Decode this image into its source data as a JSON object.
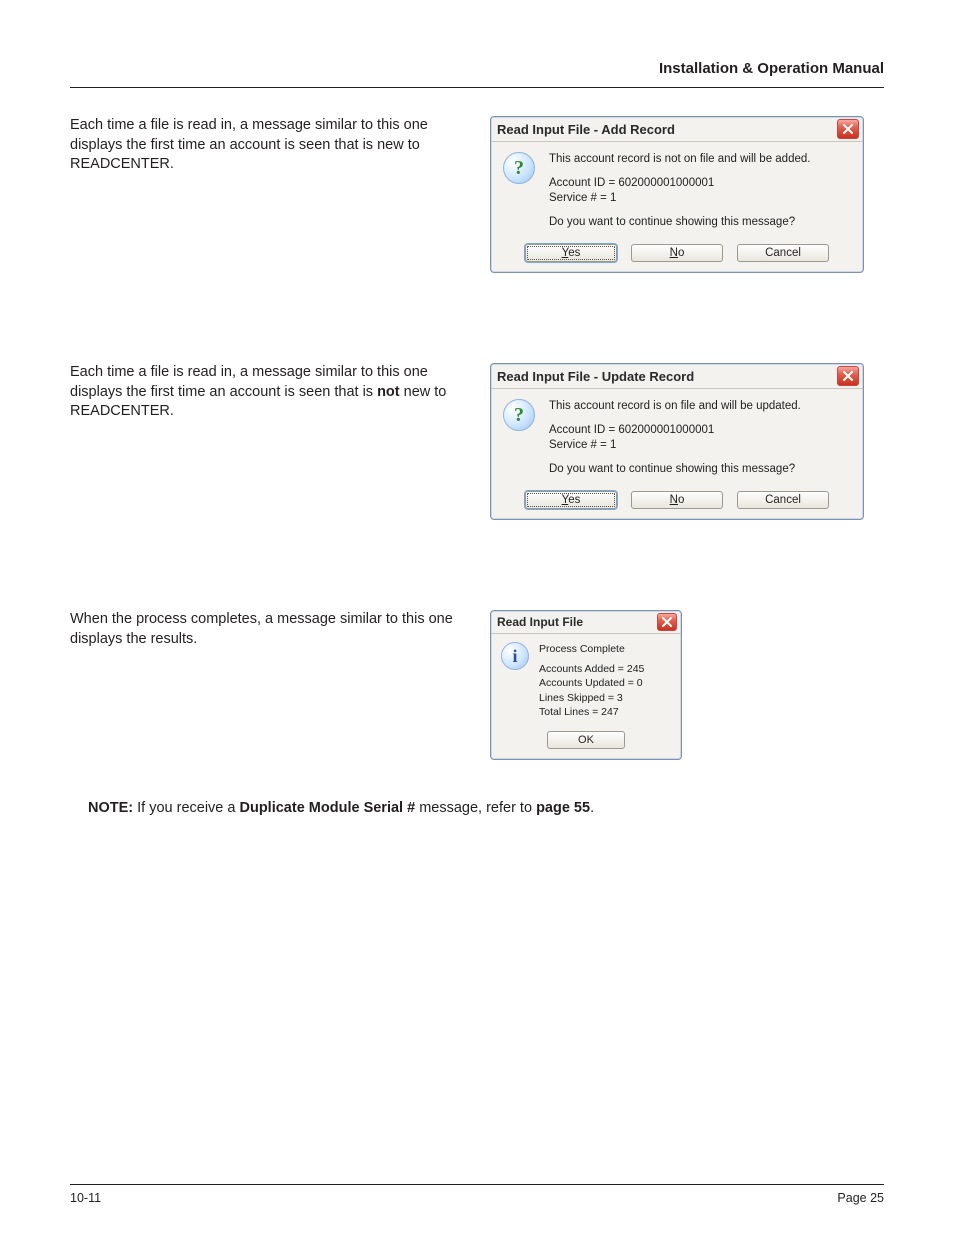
{
  "header": {
    "title": "Installation & Operation Manual"
  },
  "sections": {
    "add": {
      "copy_before": "Each time a file is read in, a message similar to this one displays the first time an account is seen that is new to ",
      "copy_brand": "READCENTER",
      "copy_after": "."
    },
    "update": {
      "copy_before": "Each time a file is read in, a message similar to this one displays the first time an account is seen that is ",
      "copy_bold": "not",
      "copy_mid": " new to ",
      "copy_brand": "READCENTER",
      "copy_after": "."
    },
    "complete": {
      "copy": "When the process completes, a message similar to this one displays the results."
    }
  },
  "dialogs": {
    "add": {
      "title": "Read Input File - Add Record",
      "line1": "This account record is not on file and will be added.",
      "account": "Account ID = 602000001000001",
      "service": "Service # = 1",
      "prompt": "Do you want to continue showing this message?",
      "buttons": {
        "yes": "Yes",
        "no": "No",
        "cancel": "Cancel"
      },
      "hotkeys": {
        "yes": "Y",
        "no": "N"
      }
    },
    "update": {
      "title": "Read Input File - Update Record",
      "line1": "This account record is on file and will be updated.",
      "account": "Account ID = 602000001000001",
      "service": "Service # = 1",
      "prompt": "Do you want to continue showing this message?",
      "buttons": {
        "yes": "Yes",
        "no": "No",
        "cancel": "Cancel"
      },
      "hotkeys": {
        "yes": "Y",
        "no": "N"
      }
    },
    "complete": {
      "title": "Read Input File",
      "line1": "Process Complete",
      "stat_added": "Accounts Added = 245",
      "stat_updated": "Accounts Updated = 0",
      "stat_skipped": "Lines Skipped = 3",
      "stat_total": "Total Lines = 247",
      "buttons": {
        "ok": "OK"
      }
    }
  },
  "note": {
    "label": "NOTE:",
    "before": " If you receive a ",
    "bold": "Duplicate Module Serial #",
    "mid": " message, refer to ",
    "link": "page 55",
    "after": "."
  },
  "footer": {
    "left": "10-11",
    "right": "Page 25"
  },
  "colors": {
    "close_button": "#d44b2f",
    "question_glyph": "#2e8b2e",
    "info_glyph": "#2a4fa0"
  }
}
